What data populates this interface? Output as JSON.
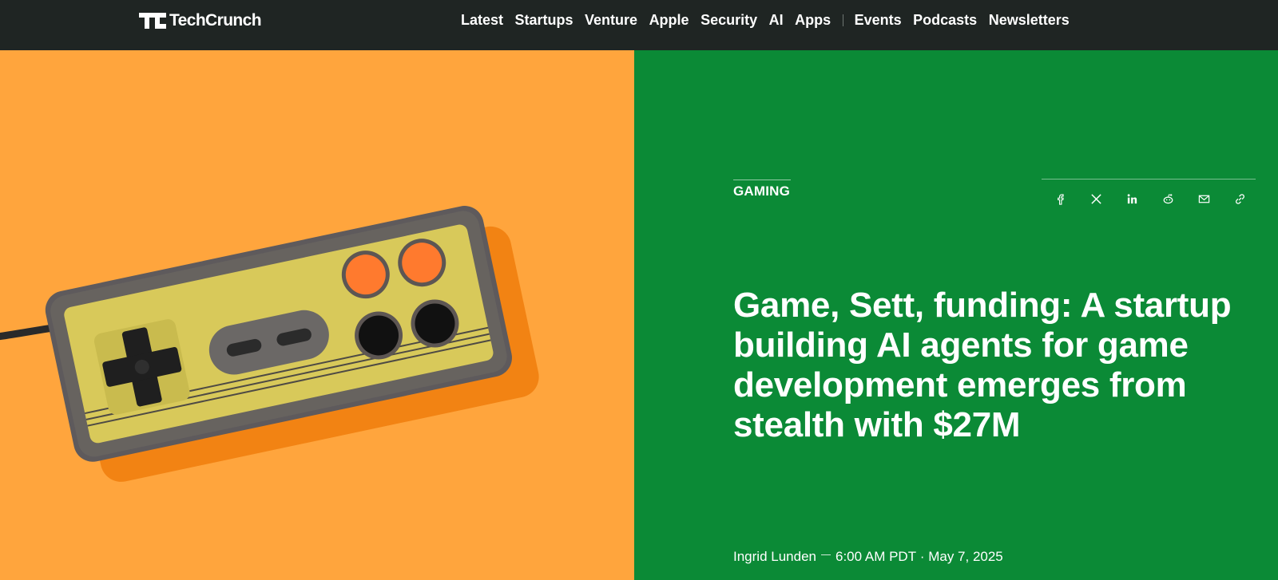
{
  "header": {
    "logo_text": "TechCrunch",
    "nav": [
      "Latest",
      "Startups",
      "Venture",
      "Apple",
      "Security",
      "AI",
      "Apps"
    ],
    "nav_secondary": [
      "Events",
      "Podcasts",
      "Newsletters"
    ]
  },
  "article": {
    "category": "GAMING",
    "headline": "Game, Sett, funding: A startup building AI agents for game development emerges from stealth with $27M",
    "author": "Ingrid Lunden",
    "time": "6:00 AM PDT",
    "date": "May 7, 2025"
  },
  "share_icons": [
    "facebook-icon",
    "x-icon",
    "linkedin-icon",
    "reddit-icon",
    "email-icon",
    "link-icon"
  ],
  "colors": {
    "header_bg": "#1f2523",
    "hero_left_bg": "#ffa53d",
    "hero_right_bg": "#0b8a36",
    "text": "#ffffff"
  }
}
